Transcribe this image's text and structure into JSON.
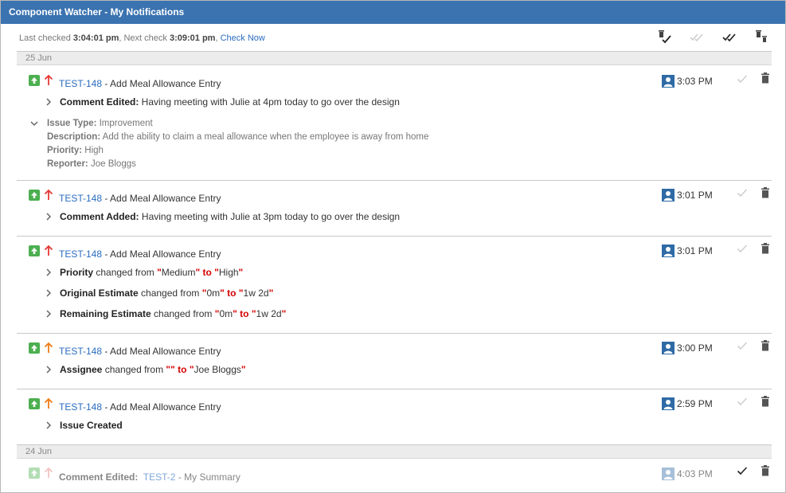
{
  "window": {
    "title": "Component Watcher - My Notifications"
  },
  "status": {
    "last_checked_label": "Last checked",
    "last_checked_time": "3:04:01 pm",
    "next_check_label": ", Next check",
    "next_check_time": "3:09:01 pm",
    "separator": ",",
    "check_now": "Check Now"
  },
  "toolbar": {
    "icons": [
      "delete-read-icon",
      "mark-read-icon",
      "mark-all-read-icon",
      "delete-all-icon"
    ]
  },
  "groups": [
    {
      "date": "25 Jun",
      "notifications": [
        {
          "issue_key": "TEST-148",
          "summary": " - Add Meal Allowance Entry",
          "time": "3:03 PM",
          "priority_color": "#e53935",
          "changes": [
            {
              "label": "Comment Edited:",
              "text": " Having meeting with Julie at 4pm today to go over the design"
            }
          ],
          "details": {
            "issue_type_label": "Issue Type:",
            "issue_type": " Improvement",
            "description_label": "Description:",
            "description": " Add the ability to claim a meal allowance when the employee is away from home",
            "priority_label": "Priority:",
            "priority": " High",
            "reporter_label": "Reporter:",
            "reporter": " Joe Bloggs"
          }
        },
        {
          "issue_key": "TEST-148",
          "summary": " - Add Meal Allowance Entry",
          "time": "3:01 PM",
          "priority_color": "#e53935",
          "changes": [
            {
              "label": "Comment Added:",
              "text": " Having meeting with Julie at 3pm today to go over the design"
            }
          ]
        },
        {
          "issue_key": "TEST-148",
          "summary": " - Add Meal Allowance Entry",
          "time": "3:01 PM",
          "priority_color": "#e53935",
          "changes": [
            {
              "label": "Priority",
              "from_text": " changed from ",
              "q1": "\"",
              "from": "Medium",
              "q2": "\"",
              "to": " to ",
              "q3": "\"",
              "to_val": "High",
              "q4": "\""
            },
            {
              "label": "Original Estimate",
              "from_text": " changed from ",
              "q1": "\"",
              "from": "0m",
              "q2": "\"",
              "to": " to ",
              "q3": "\"",
              "to_val": "1w 2d",
              "q4": "\""
            },
            {
              "label": "Remaining Estimate",
              "from_text": " changed from ",
              "q1": "\"",
              "from": "0m",
              "q2": "\"",
              "to": " to ",
              "q3": "\"",
              "to_val": "1w 2d",
              "q4": "\""
            }
          ]
        },
        {
          "issue_key": "TEST-148",
          "summary": " - Add Meal Allowance Entry",
          "time": "3:00 PM",
          "priority_color": "#f07c16",
          "changes": [
            {
              "label": "Assignee",
              "from_text": " changed from ",
              "q1": "\"",
              "from": "",
              "q2": "\"",
              "to": " to ",
              "q3": "\"",
              "to_val": "Joe Bloggs",
              "q4": "\""
            }
          ]
        },
        {
          "issue_key": "TEST-148",
          "summary": " - Add Meal Allowance Entry",
          "time": "2:59 PM",
          "priority_color": "#f07c16",
          "changes": [
            {
              "label": "Issue Created",
              "text": ""
            }
          ]
        }
      ]
    },
    {
      "date": "24 Jun",
      "notifications": [
        {
          "prefix": "Comment Edited:",
          "issue_key": "TEST-2",
          "summary": " - My Summary",
          "time": "4:03 PM",
          "read": true
        }
      ]
    }
  ],
  "colors": {
    "title_bar": "#3b73b0",
    "link": "#2a6cc0",
    "change_highlight": "#d40000",
    "badge_green": "#4caf50",
    "avatar_blue": "#2f6aa5"
  }
}
